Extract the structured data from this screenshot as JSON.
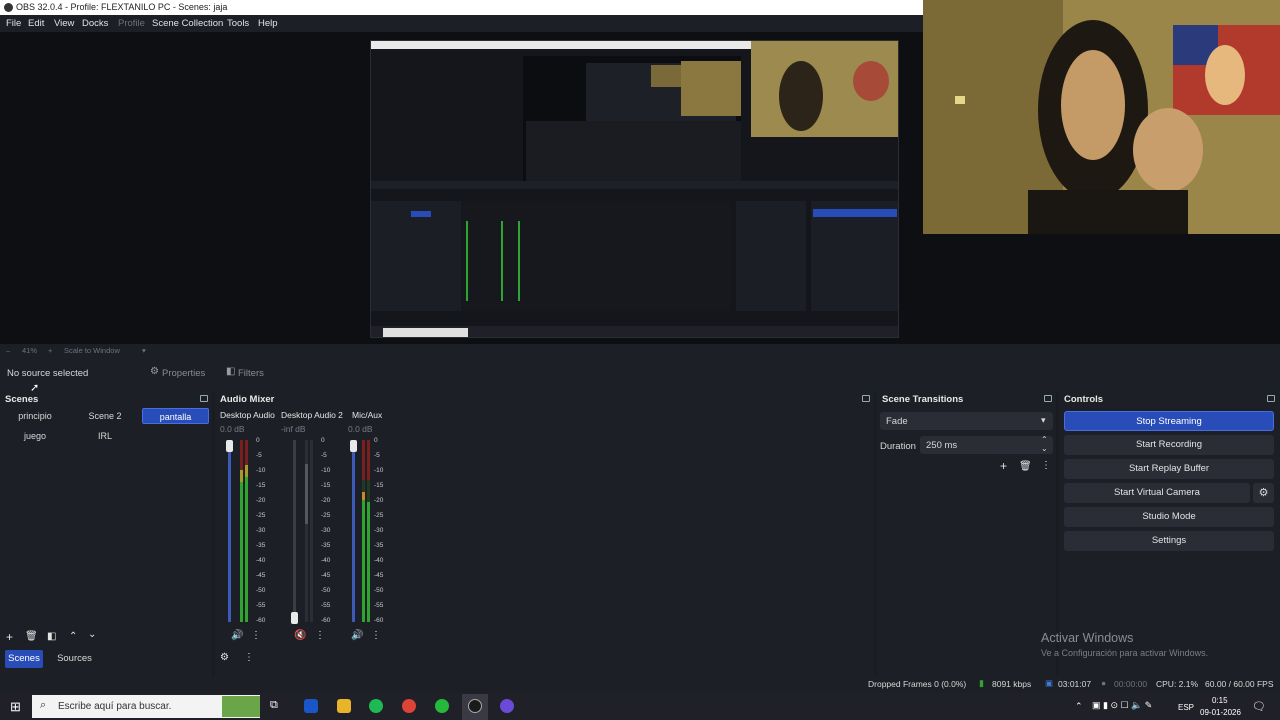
{
  "window": {
    "title": "OBS 32.0.4 - Profile: FLEXTANILO PC - Scenes: jaja"
  },
  "menu": [
    "File",
    "Edit",
    "View",
    "Docks",
    "Profile",
    "Scene Collection",
    "Tools",
    "Help"
  ],
  "preview_bar": {
    "zoom": "41%",
    "scale_mode": "Scale to Window"
  },
  "source_bar": {
    "no_source": "No source selected",
    "properties": "Properties",
    "filters": "Filters"
  },
  "scenes": {
    "title": "Scenes",
    "items": [
      "principio",
      "Scene 2",
      "pantalla",
      "juego",
      "IRL"
    ],
    "active": "pantalla"
  },
  "dock_tabs": {
    "scenes": "Scenes",
    "sources": "Sources"
  },
  "audio_mixer": {
    "title": "Audio Mixer",
    "channels": [
      {
        "name": "Desktop Audio",
        "db": "0.0 dB",
        "level": 1.0
      },
      {
        "name": "Desktop Audio 2",
        "db": "-inf dB",
        "level": 0.0
      },
      {
        "name": "Mic/Aux",
        "db": "0.0 dB",
        "level": 1.0
      }
    ],
    "ticks": [
      "0",
      "-5",
      "-10",
      "-15",
      "-20",
      "-25",
      "-30",
      "-35",
      "-40",
      "-45",
      "-50",
      "-55",
      "-60"
    ]
  },
  "scene_transitions": {
    "title": "Scene Transitions",
    "transition": "Fade",
    "duration_label": "Duration",
    "duration_value": "250 ms"
  },
  "controls": {
    "title": "Controls",
    "buttons": [
      "Stop Streaming",
      "Start Recording",
      "Start Replay Buffer",
      "Start Virtual Camera",
      "Studio Mode",
      "Settings"
    ]
  },
  "watermark": {
    "line1": "Activar Windows",
    "line2": "Ve a Configuración para activar Windows."
  },
  "status": {
    "dropped": "Dropped Frames 0 (0.0%)",
    "bitrate": "8091 kbps",
    "stream_time": "03:01:07",
    "rec_time": "00:00:00",
    "cpu": "CPU: 2.1%",
    "fps": "60.00 / 60.00 FPS"
  },
  "taskbar": {
    "search_placeholder": "Escribe aquí para buscar.",
    "lang": "ESP",
    "time": "0:15",
    "date": "09-01-2026"
  },
  "colors": {
    "accent": "#284cb8",
    "background": "#1d1f26",
    "meter_green": "#2fa52f"
  }
}
